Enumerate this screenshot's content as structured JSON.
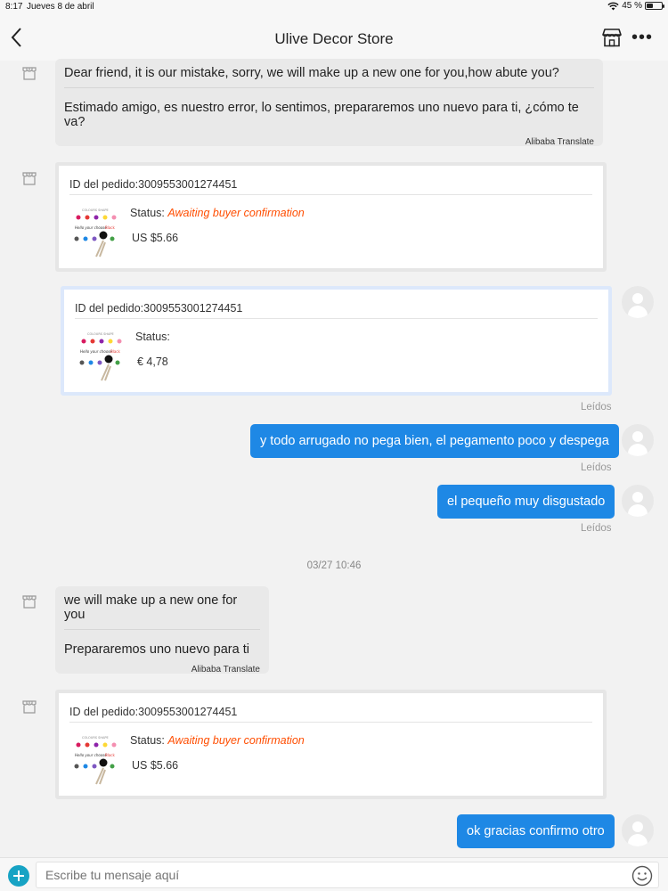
{
  "status_bar": {
    "time": "8:17",
    "date": "Jueves 8 de abril",
    "battery": "45 %",
    "battery_level": 0.45
  },
  "header": {
    "title": "Ulive Decor Store"
  },
  "messages": {
    "m1": {
      "original": "Dear friend, it is our mistake, sorry, we will make up a new one for you,how abute you?",
      "translated": "Estimado amigo, es nuestro error, lo sentimos, prepararemos uno nuevo para ti, ¿cómo te va?",
      "credit": "Alibaba Translate"
    },
    "order1": {
      "id_label": "ID del pedido:3009553001274451",
      "status_label": "Status:",
      "status_value": "Awaiting buyer confirmation",
      "price": "US $5.66"
    },
    "order2": {
      "id_label": "ID del pedido:3009553001274451",
      "status_label": "Status:",
      "price": "€ 4,78",
      "read": "Leídos"
    },
    "out1": {
      "text": "y todo arrugado no pega bien, el pegamento poco y despega",
      "read": "Leídos"
    },
    "out2": {
      "text": "el pequeño muy disgustado",
      "read": "Leídos"
    },
    "timestamp": "03/27 10:46",
    "m2": {
      "original": "we will make up a new one for you",
      "translated": "Prepararemos uno nuevo para ti",
      "credit": "Alibaba Translate"
    },
    "order3": {
      "id_label": "ID del pedido:3009553001274451",
      "status_label": "Status:",
      "status_value": "Awaiting buyer confirmation",
      "price": "US $5.66"
    },
    "out3": {
      "text": "ok gracias confirmo otro"
    }
  },
  "input": {
    "placeholder": "Escribe tu mensaje aquí"
  },
  "colors": {
    "accent": "#1e88e5",
    "status_orange": "#ff4d00",
    "plus_button": "#17a3c4"
  }
}
